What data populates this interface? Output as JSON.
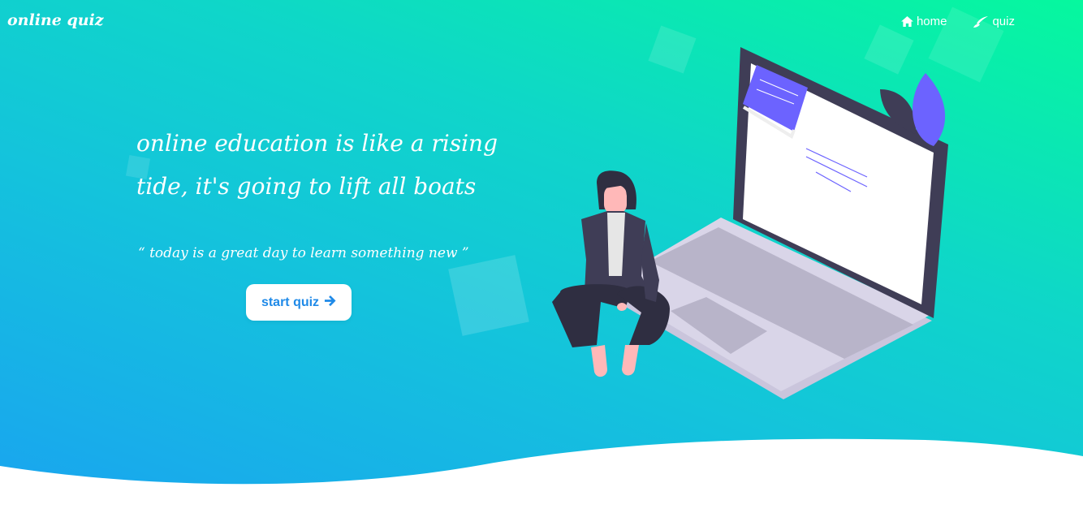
{
  "brand": {
    "logo_text": "online quiz"
  },
  "nav": {
    "items": [
      {
        "label": "home",
        "icon": "home-icon"
      },
      {
        "label": "quiz",
        "icon": "quill-icon"
      }
    ]
  },
  "hero": {
    "headline_line1": "online education is like a rising",
    "headline_line2": "tide, it's going to lift all boats",
    "quote": "“ today is a great day to learn something new ”",
    "cta_label": "start quiz",
    "cta_icon": "arrow-right-icon"
  },
  "colors": {
    "gradient_top_right": "#06f89e",
    "gradient_bottom_left": "#1aa2f1",
    "button_text": "#1f8ae8",
    "accent_purple": "#6c63ff"
  }
}
